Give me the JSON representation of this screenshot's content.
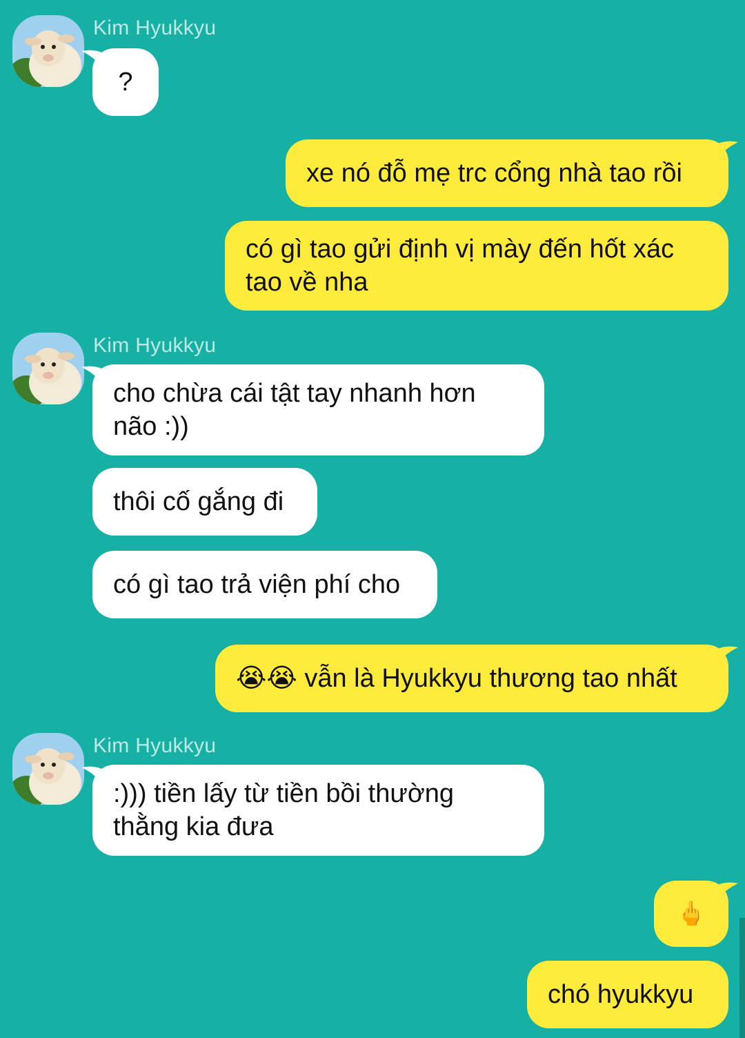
{
  "contact": {
    "name": "Kim Hyukkyu",
    "avatar_icon": "sheep-avatar-icon"
  },
  "messages": [
    {
      "from": "Kim Hyukkyu",
      "text": "?"
    },
    {
      "from": "me",
      "text": "xe nó đỗ mẹ trc cổng nhà tao rồi"
    },
    {
      "from": "me",
      "text": "có gì tao gửi định vị mày đến hốt xác tao về nha"
    },
    {
      "from": "Kim Hyukkyu",
      "text": "cho chừa cái tật tay nhanh hơn não :))"
    },
    {
      "from": "Kim Hyukkyu",
      "text": "thôi cố gắng đi"
    },
    {
      "from": "Kim Hyukkyu",
      "text": "có gì tao trả viện phí cho"
    },
    {
      "from": "me",
      "text": "😭😭 vẫn là Hyukkyu thương tao nhất"
    },
    {
      "from": "Kim Hyukkyu",
      "text": ":))) tiền lấy từ tiền bồi thường thằng kia đưa"
    },
    {
      "from": "me",
      "text": "🖕"
    },
    {
      "from": "me",
      "text": "chó hyukkyu"
    }
  ],
  "colors": {
    "background": "#17b0a4",
    "incoming": "#ffffff",
    "outgoing": "#ffeb3b",
    "sender_name": "#bfe9e4"
  }
}
